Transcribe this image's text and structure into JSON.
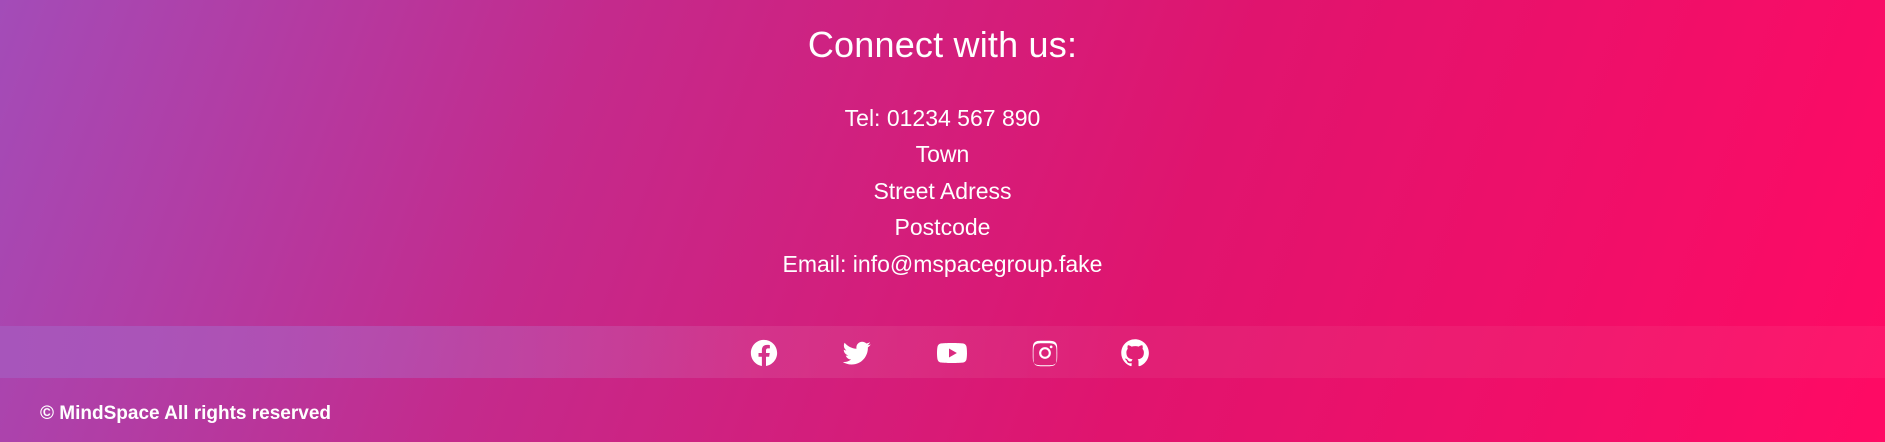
{
  "contact": {
    "heading": "Connect with us:",
    "tel": "Tel: 01234 567 890",
    "town": "Town",
    "street": "Street Adress",
    "postcode": "Postcode",
    "email": "Email: info@mspacegroup.fake"
  },
  "social": [
    {
      "name": "facebook-icon"
    },
    {
      "name": "twitter-icon"
    },
    {
      "name": "youtube-icon"
    },
    {
      "name": "instagram-icon"
    },
    {
      "name": "github-icon"
    }
  ],
  "footer": {
    "copyright": "© MindSpace All rights reserved"
  },
  "colors": {
    "gradient_start": "#a34cb8",
    "gradient_end": "#ff0a64",
    "text": "#ffffff"
  }
}
